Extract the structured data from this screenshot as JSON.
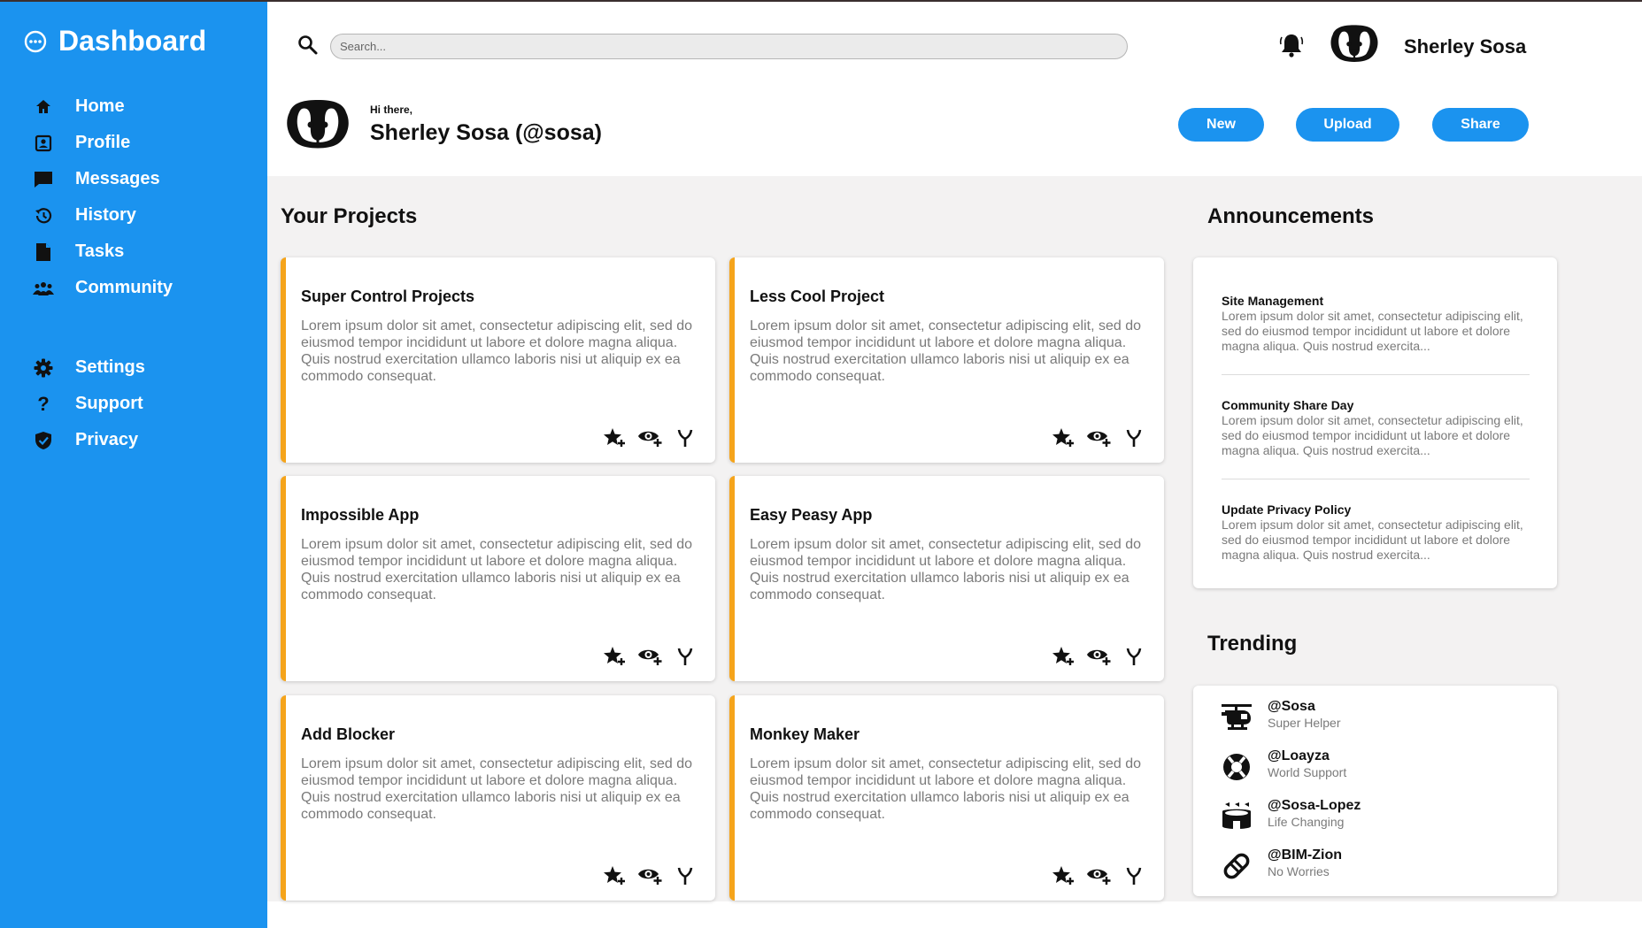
{
  "sidebar": {
    "brand": "Dashboard",
    "nav": [
      {
        "label": "Home",
        "icon": "home-icon"
      },
      {
        "label": "Profile",
        "icon": "profile-icon"
      },
      {
        "label": "Messages",
        "icon": "messages-icon"
      },
      {
        "label": "History",
        "icon": "history-icon"
      },
      {
        "label": "Tasks",
        "icon": "tasks-icon"
      },
      {
        "label": "Community",
        "icon": "community-icon"
      }
    ],
    "nav2": [
      {
        "label": "Settings",
        "icon": "settings-icon"
      },
      {
        "label": "Support",
        "icon": "support-icon"
      },
      {
        "label": "Privacy",
        "icon": "privacy-icon"
      }
    ]
  },
  "topbar": {
    "search_placeholder": "Search...",
    "username": "Sherley Sosa"
  },
  "greeting": {
    "hi": "Hi there,",
    "name": "Sherley Sosa (@sosa)",
    "buttons": {
      "new": "New",
      "upload": "Upload",
      "share": "Share"
    }
  },
  "projects": {
    "title": "Your Projects",
    "cards": [
      {
        "title": "Super Control Projects",
        "desc": "Lorem ipsum dolor sit amet, consectetur adipiscing elit, sed do eiusmod tempor incididunt ut labore et dolore magna aliqua. Quis nostrud exercitation ullamco laboris nisi ut aliquip ex ea commodo consequat."
      },
      {
        "title": "Less Cool Project",
        "desc": "Lorem ipsum dolor sit amet, consectetur adipiscing elit, sed do eiusmod tempor incididunt ut labore et dolore magna aliqua. Quis nostrud exercitation ullamco laboris nisi ut aliquip ex ea commodo consequat."
      },
      {
        "title": "Impossible App",
        "desc": "Lorem ipsum dolor sit amet, consectetur adipiscing elit, sed do eiusmod tempor incididunt ut labore et dolore magna aliqua. Quis nostrud exercitation ullamco laboris nisi ut aliquip ex ea commodo consequat."
      },
      {
        "title": "Easy Peasy App",
        "desc": "Lorem ipsum dolor sit amet, consectetur adipiscing elit, sed do eiusmod tempor incididunt ut labore et dolore magna aliqua. Quis nostrud exercitation ullamco laboris nisi ut aliquip ex ea commodo consequat."
      },
      {
        "title": "Add Blocker",
        "desc": "Lorem ipsum dolor sit amet, consectetur adipiscing elit, sed do eiusmod tempor incididunt ut labore et dolore magna aliqua. Quis nostrud exercitation ullamco laboris nisi ut aliquip ex ea commodo consequat."
      },
      {
        "title": "Monkey Maker",
        "desc": "Lorem ipsum dolor sit amet, consectetur adipiscing elit, sed do eiusmod tempor incididunt ut labore et dolore magna aliqua. Quis nostrud exercitation ullamco laboris nisi ut aliquip ex ea commodo consequat."
      }
    ]
  },
  "announcements": {
    "title": "Announcements",
    "items": [
      {
        "title": "Site Management",
        "desc": "Lorem ipsum dolor sit amet, consectetur adipiscing elit, sed do eiusmod tempor incididunt ut labore et dolore magna aliqua. Quis nostrud exercita..."
      },
      {
        "title": "Community Share Day",
        "desc": "Lorem ipsum dolor sit amet, consectetur adipiscing elit, sed do eiusmod tempor incididunt ut labore et dolore magna aliqua. Quis nostrud exercita..."
      },
      {
        "title": "Update Privacy Policy",
        "desc": "Lorem ipsum dolor sit amet, consectetur adipiscing elit, sed do eiusmod tempor incididunt ut labore et dolore magna aliqua. Quis nostrud exercita..."
      }
    ]
  },
  "trending": {
    "title": "Trending",
    "items": [
      {
        "handle": "@Sosa",
        "subtitle": "Super Helper",
        "icon": "helicopter-icon"
      },
      {
        "handle": "@Loayza",
        "subtitle": "World Support",
        "icon": "lifebuoy-icon"
      },
      {
        "handle": "@Sosa-Lopez",
        "subtitle": "Life Changing",
        "icon": "stadium-icon"
      },
      {
        "handle": "@BIM-Zion",
        "subtitle": "No Worries",
        "icon": "pill-icon"
      }
    ]
  },
  "colors": {
    "accent": "#1b93ef",
    "card_border": "#f5a41b",
    "background": "#f3f2f2"
  }
}
